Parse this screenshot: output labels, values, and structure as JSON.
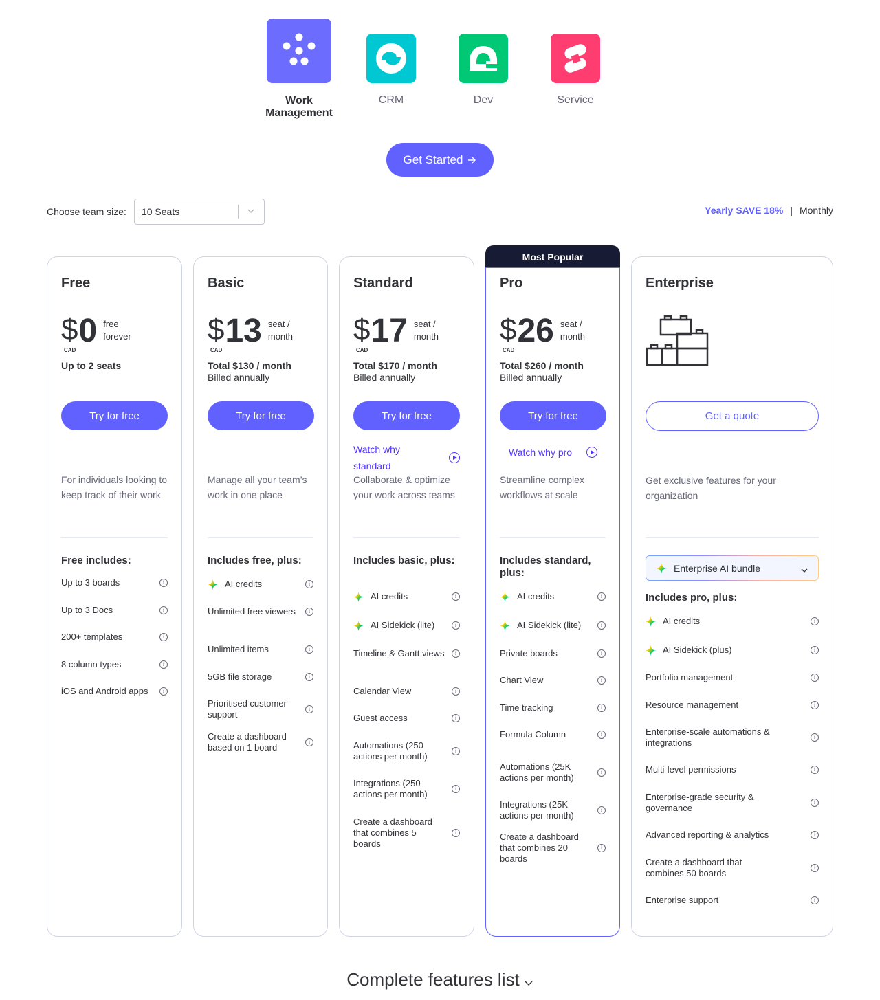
{
  "products": [
    {
      "label": "Work Management",
      "line1": "Work",
      "line2": "Management",
      "color": "#6c6cff",
      "icon": "dots-icon"
    },
    {
      "label": "CRM",
      "color": "#00c8d2",
      "icon": "crm-icon"
    },
    {
      "label": "Dev",
      "color": "#00c875",
      "icon": "dev-icon"
    },
    {
      "label": "Service",
      "color": "#ff3d71",
      "icon": "service-icon"
    }
  ],
  "get_started": "Get Started",
  "team": {
    "label": "Choose team size:",
    "value": "10 Seats"
  },
  "billing": {
    "yearly": "Yearly SAVE 18%",
    "separator": "|",
    "monthly": "Monthly"
  },
  "most_popular": "Most Popular",
  "plans": {
    "free": {
      "name": "Free",
      "currency": "$",
      "amount": "0",
      "unit": "free forever",
      "cad": "CAD",
      "total": "Up to 2 seats",
      "billed": "",
      "cta": "Try for free",
      "desc": "For individuals looking to keep track of their work",
      "includes": "Free includes:",
      "features": [
        "Up to 3 boards",
        "Up to 3 Docs",
        "200+ templates",
        "8 column types",
        "iOS and Android apps"
      ]
    },
    "basic": {
      "name": "Basic",
      "currency": "$",
      "amount": "13",
      "unit": "seat / month",
      "cad": "CAD",
      "total": "Total $130 / month",
      "billed": "Billed annually",
      "cta": "Try for free",
      "desc": "Manage all your team’s work in one place",
      "includes": "Includes free, plus:",
      "features": [
        "AI credits",
        "Unlimited free viewers",
        "Unlimited items",
        "5GB file storage",
        "Prioritised customer support",
        "Create a dashboard based on 1 board"
      ]
    },
    "standard": {
      "name": "Standard",
      "currency": "$",
      "amount": "17",
      "unit": "seat / month",
      "cad": "CAD",
      "total": "Total $170 / month",
      "billed": "Billed annually",
      "cta": "Try for free",
      "watch": "Watch why standard",
      "desc": "Collaborate & optimize your work across teams",
      "includes": "Includes basic, plus:",
      "features": [
        "AI credits",
        "AI Sidekick (lite)",
        "Timeline & Gantt views",
        "Calendar View",
        "Guest access",
        "Automations (250 actions per month)",
        "Integrations (250 actions per month)",
        "Create a dashboard that combines 5 boards"
      ]
    },
    "pro": {
      "name": "Pro",
      "currency": "$",
      "amount": "26",
      "unit": "seat / month",
      "cad": "CAD",
      "total": "Total $260 / month",
      "billed": "Billed annually",
      "cta": "Try for free",
      "watch": "Watch why pro",
      "desc": "Streamline complex workflows at scale",
      "includes": "Includes standard, plus:",
      "features": [
        "AI credits",
        "AI Sidekick (lite)",
        "Private boards",
        "Chart View",
        "Time tracking",
        "Formula Column",
        "Automations (25K actions per month)",
        "Integrations (25K actions per month)",
        "Create a dashboard that combines 20 boards"
      ]
    },
    "enterprise": {
      "name": "Enterprise",
      "cta": "Get a quote",
      "desc": "Get exclusive features for your organization",
      "bundle": "Enterprise AI bundle",
      "includes": "Includes pro, plus:",
      "features": [
        "AI credits",
        "AI Sidekick (plus)",
        "Portfolio management",
        "Resource management",
        "Enterprise-scale automations & integrations",
        "Multi-level permissions",
        "Enterprise-grade security & governance",
        "Advanced reporting & analytics",
        "Create a dashboard that combines 50 boards",
        "Enterprise support"
      ]
    }
  },
  "complete_features": "Complete features list",
  "colors": {
    "accent": "#6161ff",
    "dark": "#181b34",
    "text": "#323338",
    "muted": "#676879"
  }
}
